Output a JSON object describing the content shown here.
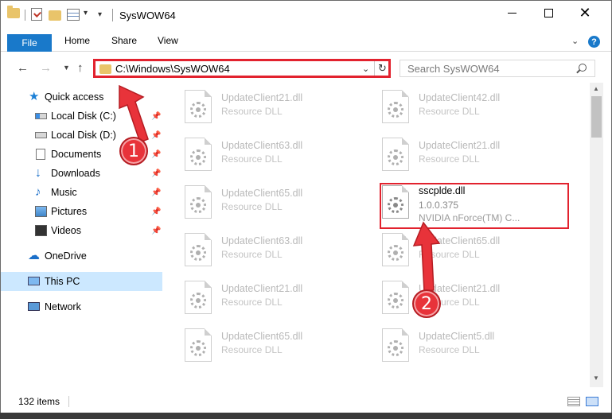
{
  "window": {
    "title": "SysWOW64"
  },
  "ribbon": {
    "tabs": [
      "File",
      "Home",
      "Share",
      "View"
    ],
    "help": "?"
  },
  "nav": {
    "address": "C:\\Windows\\SysWOW64",
    "search_placeholder": "Search SysWOW64"
  },
  "sidebar": {
    "items": [
      {
        "label": "Quick access",
        "icon": "quick-access-star-icon",
        "pinned": false
      },
      {
        "label": "Local Disk (C:)",
        "icon": "drive-icon",
        "pinned": true
      },
      {
        "label": "Local Disk (D:)",
        "icon": "drive-icon",
        "pinned": true
      },
      {
        "label": "Documents",
        "icon": "documents-icon",
        "pinned": true
      },
      {
        "label": "Downloads",
        "icon": "downloads-icon",
        "pinned": true
      },
      {
        "label": "Music",
        "icon": "music-icon",
        "pinned": true
      },
      {
        "label": "Pictures",
        "icon": "pictures-icon",
        "pinned": true
      },
      {
        "label": "Videos",
        "icon": "videos-icon",
        "pinned": true
      },
      {
        "label": "OneDrive",
        "icon": "onedrive-icon",
        "pinned": false
      },
      {
        "label": "This PC",
        "icon": "this-pc-icon",
        "pinned": false,
        "selected": true
      },
      {
        "label": "Network",
        "icon": "network-icon",
        "pinned": false
      }
    ]
  },
  "files": [
    {
      "name": "UpdateClient21.dll",
      "desc": "Resource DLL"
    },
    {
      "name": "UpdateClient42.dll",
      "desc": "Resource DLL"
    },
    {
      "name": "UpdateClient63.dll",
      "desc": "Resource DLL"
    },
    {
      "name": "UpdateClient21.dll",
      "desc": "Resource DLL"
    },
    {
      "name": "UpdateClient65.dll",
      "desc": "Resource DLL"
    },
    {
      "name": "sscplde.dll",
      "desc": "1.0.0.375",
      "desc2": "NVIDIA nForce(TM) C...",
      "highlighted": true
    },
    {
      "name": "UpdateClient63.dll",
      "desc": "Resource DLL"
    },
    {
      "name": "UpdateClient65.dll",
      "desc": "Resource DLL"
    },
    {
      "name": "UpdateClient21.dll",
      "desc": "Resource DLL"
    },
    {
      "name": "UpdateClient21.dll",
      "desc": "Resource DLL"
    },
    {
      "name": "UpdateClient65.dll",
      "desc": "Resource DLL"
    },
    {
      "name": "UpdateClient5.dll",
      "desc": "Resource DLL"
    }
  ],
  "status": {
    "item_count": "132 items"
  },
  "callouts": {
    "step1": "1",
    "step2": "2"
  },
  "colors": {
    "accent": "#1979ca",
    "callout_red": "#e2222e",
    "selection": "#cce8ff"
  }
}
